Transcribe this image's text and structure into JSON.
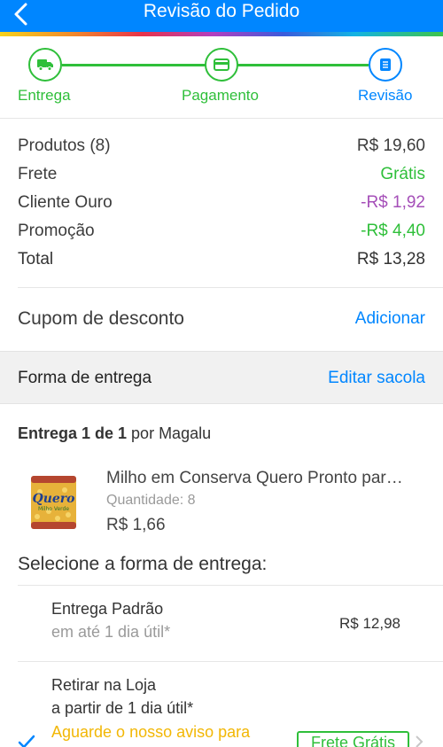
{
  "header": {
    "title": "Revisão do Pedido",
    "back_icon": "chevron-left-icon"
  },
  "colors": {
    "primary": "#0086ff",
    "success": "#2fbf3a",
    "purple": "#a54fb8",
    "warning": "#f2b705"
  },
  "stepper": {
    "steps": [
      {
        "label": "Entrega",
        "icon": "truck-icon",
        "state": "done"
      },
      {
        "label": "Pagamento",
        "icon": "credit-card-icon",
        "state": "done"
      },
      {
        "label": "Revisão",
        "icon": "document-icon",
        "state": "current"
      }
    ]
  },
  "summary": {
    "rows": [
      {
        "label": "Produtos (8)",
        "value": "R$ 19,60"
      },
      {
        "label": "Frete",
        "value": "Grátis"
      },
      {
        "label": "Cliente Ouro",
        "value": "-R$ 1,92"
      },
      {
        "label": "Promoção",
        "value": "-R$ 4,40"
      },
      {
        "label": "Total",
        "value": "R$ 13,28"
      }
    ]
  },
  "coupon": {
    "label": "Cupom de desconto",
    "action": "Adicionar"
  },
  "delivery_section": {
    "title": "Forma de entrega",
    "action": "Editar sacola"
  },
  "shipment": {
    "title_bold": "Entrega 1 de 1",
    "title_rest": " por Magalu",
    "product": {
      "name": "Milho em Conserva Quero Pronto par…",
      "quantity": "Quantidade: 8",
      "price": "R$ 1,66",
      "image_brand": "Quero",
      "image_text": "Milho Verde"
    }
  },
  "delivery_options": {
    "title": "Selecione a forma de entrega:",
    "options": [
      {
        "name": "Entrega Padrão",
        "sub": "em até 1 dia útil*",
        "price": "R$ 12,98"
      },
      {
        "name": "Retirar na Loja",
        "sub": "a partir de 1 dia útil*",
        "notice": "Aguarde o nosso aviso para",
        "badge": "Frete Grátis",
        "selected": true
      }
    ]
  }
}
